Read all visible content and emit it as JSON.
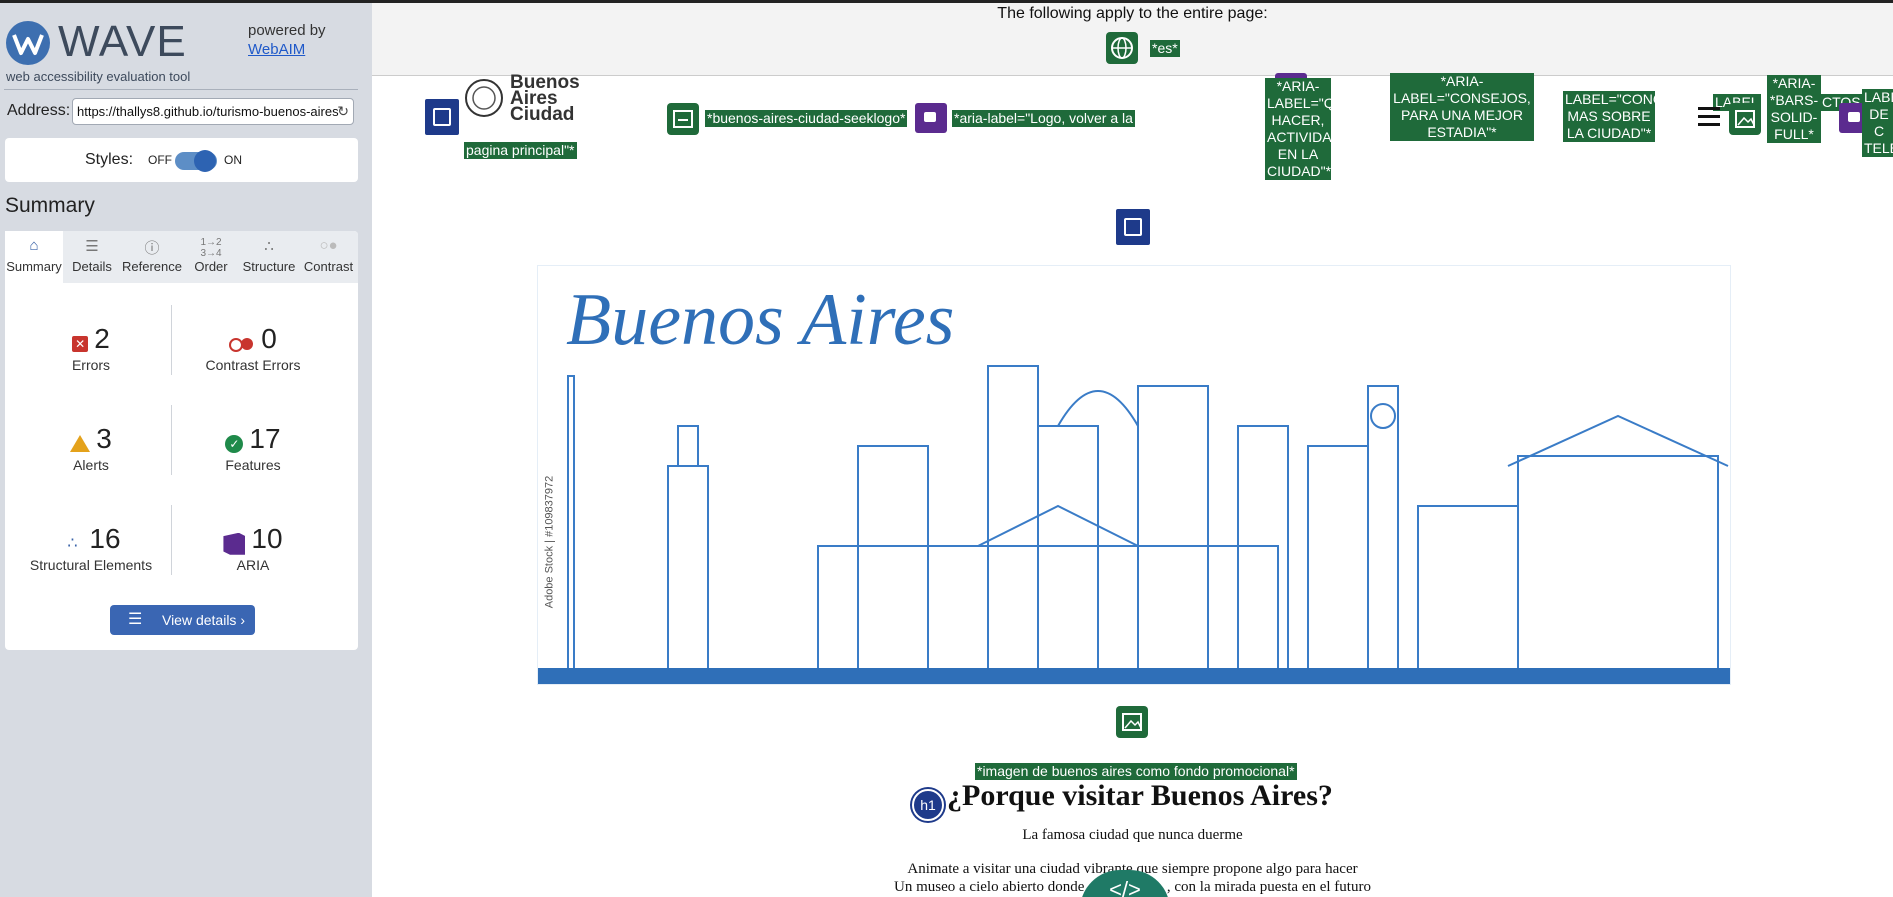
{
  "wave": {
    "logo_text": "WAVE",
    "logo_sub": "web accessibility evaluation tool",
    "powered_by": "powered by",
    "webaim_link": "WebAIM",
    "address_label": "Address:",
    "address_value": "https://thallys8.github.io/turismo-buenos-aires",
    "styles_label": "Styles:",
    "toggle_off": "OFF",
    "toggle_on": "ON",
    "summary_title": "Summary",
    "tabs": [
      {
        "label": "Summary",
        "icon": "home-icon"
      },
      {
        "label": "Details",
        "icon": "list-icon"
      },
      {
        "label": "Reference",
        "icon": "info-icon"
      },
      {
        "label": "Order",
        "icon": "order-icon"
      },
      {
        "label": "Structure",
        "icon": "structure-icon"
      },
      {
        "label": "Contrast",
        "icon": "contrast-icon"
      }
    ],
    "stats": [
      {
        "label": "Errors",
        "value": "2"
      },
      {
        "label": "Contrast Errors",
        "value": "0"
      },
      {
        "label": "Alerts",
        "value": "3"
      },
      {
        "label": "Features",
        "value": "17"
      },
      {
        "label": "Structural Elements",
        "value": "16"
      },
      {
        "label": "ARIA",
        "value": "10"
      }
    ],
    "view_details": "View details ›",
    "colors": {
      "accent": "#3a66b3",
      "error": "#c8352e",
      "feature": "#1f6a3a",
      "aria": "#5b2b8f"
    }
  },
  "page": {
    "banner_text": "The following apply to the entire page:",
    "lang_label": "*es*",
    "logo_text": "Buenos Aires Ciudad",
    "label_pagina": "pagina principal\"*",
    "label_seeklogo": "*buenos-aires-ciudad-seeklogo*",
    "label_aria_logo": "*aria-label=\"Logo, volver a la",
    "label_que_hacer": "*ARIA-LABEL=\"QUE HACER, ACTIVIDADES EN LA CIUDAD\"*",
    "label_consejos": "*ARIA-LABEL=\"CONSEJOS, PARA UNA MEJOR ESTADIA\"*",
    "label_conoce": "LABEL=\"CONOCE MAS SOBRE LA CIUDAD\"*",
    "label_label": "LABEL",
    "label_bars": "*ARIA-*BARS-SOLID-FULL*",
    "label_ctos": "CTOS",
    "label_right": "LABEL DE C TELE",
    "hero_title": "Buenos Aires",
    "hero_watermark": "Adobe Stock | #109837972",
    "label_img": "*imagen de buenos aires como fondo promocional*",
    "h1_badge": "h1",
    "h1": "¿Porque visitar Buenos Aires?",
    "subtitle": "La famosa ciudad que nunca duerme",
    "para_line1": "Animate a visitar una ciudad vibrante que siempre propone algo para hacer",
    "para_line2": "Un museo a cielo abierto donde                      , con la mirada puesta en el futuro",
    "code_badge": "</>"
  }
}
